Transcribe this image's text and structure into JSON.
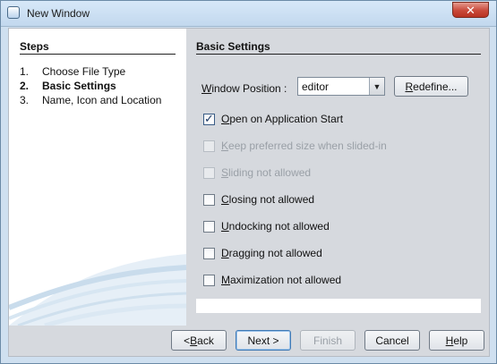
{
  "window": {
    "title": "New Window",
    "close_label": "✕"
  },
  "steps": {
    "title": "Steps",
    "items": [
      {
        "num": "1.",
        "label": "Choose File Type",
        "current": false
      },
      {
        "num": "2.",
        "label": "Basic Settings",
        "current": true
      },
      {
        "num": "3.",
        "label": "Name, Icon and Location",
        "current": false
      }
    ]
  },
  "main": {
    "title": "Basic Settings",
    "window_position": {
      "label_first": "W",
      "label_rest": "indow Position :",
      "value": "editor",
      "redefine_first": "R",
      "redefine_rest": "edefine..."
    },
    "options": [
      {
        "first": "O",
        "rest": "pen on Application Start",
        "checked": true,
        "enabled": true
      },
      {
        "first": "K",
        "rest": "eep preferred size when slided-in",
        "checked": false,
        "enabled": false
      },
      {
        "first": "S",
        "rest": "liding not allowed",
        "checked": false,
        "enabled": false
      },
      {
        "first": "C",
        "rest": "losing not allowed",
        "checked": false,
        "enabled": true
      },
      {
        "first": "U",
        "rest": "ndocking not allowed",
        "checked": false,
        "enabled": true
      },
      {
        "first": "D",
        "rest": "ragging not allowed",
        "checked": false,
        "enabled": true
      },
      {
        "first": "M",
        "rest": "aximization not allowed",
        "checked": false,
        "enabled": true
      }
    ]
  },
  "buttons": {
    "back_prefix": "< ",
    "back_first": "B",
    "back_rest": "ack",
    "next": "Next >",
    "finish": "Finish",
    "cancel": "Cancel",
    "help_first": "H",
    "help_rest": "elp"
  }
}
